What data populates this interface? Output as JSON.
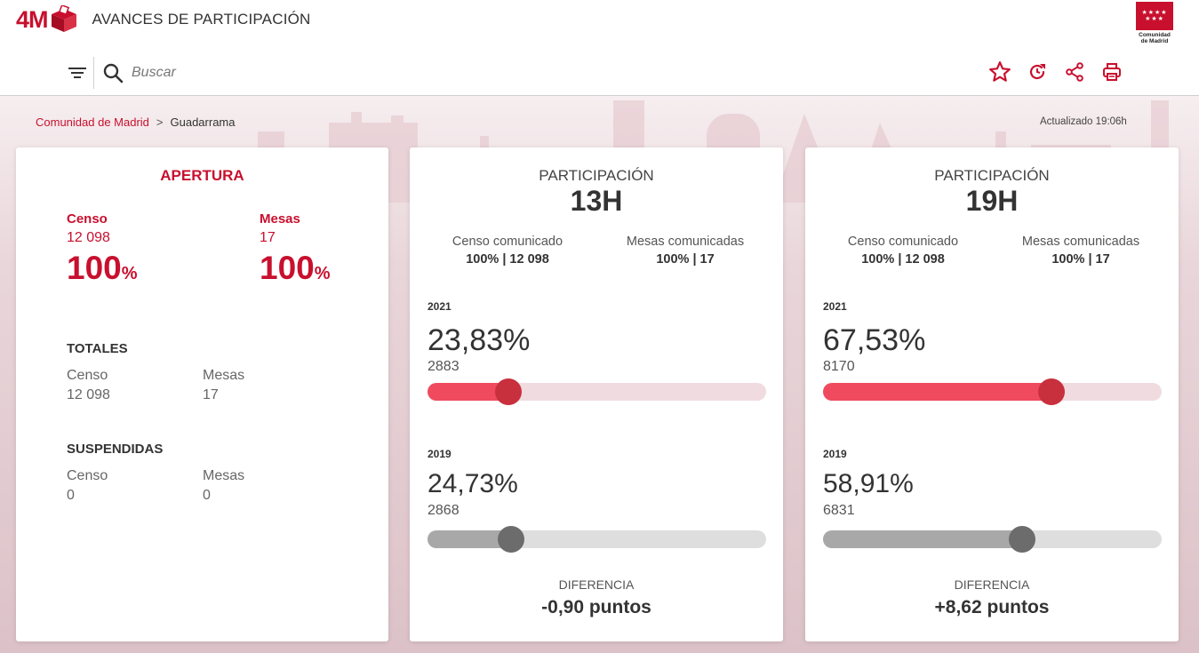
{
  "header": {
    "logo_text": "4M",
    "title": "AVANCES DE PARTICIPACIÓN",
    "brand_logo_text": "Comunidad de Madrid",
    "search_placeholder": "Buscar",
    "icons": [
      "filter-icon",
      "search-icon",
      "star-icon",
      "refresh-icon",
      "share-icon",
      "print-icon"
    ],
    "accent_color": "#c8102e"
  },
  "breadcrumb": {
    "root": "Comunidad de Madrid",
    "separator": ">",
    "current": "Guadarrama"
  },
  "updated": "Actualizado 19:06h",
  "apertura": {
    "title": "APERTURA",
    "censo_label": "Censo",
    "censo_value": "12 098",
    "censo_pct": "100",
    "mesas_label": "Mesas",
    "mesas_value": "17",
    "mesas_pct": "100",
    "pct_symbol": "%",
    "totales": {
      "title": "TOTALES",
      "censo_label": "Censo",
      "censo_value": "12 098",
      "mesas_label": "Mesas",
      "mesas_value": "17"
    },
    "suspendidas": {
      "title": "SUSPENDIDAS",
      "censo_label": "Censo",
      "censo_value": "0",
      "mesas_label": "Mesas",
      "mesas_value": "0"
    }
  },
  "participacion": [
    {
      "heading": "PARTICIPACIÓN",
      "hour": "13H",
      "censo_label": "Censo comunicado",
      "censo_value": "100% | 12 098",
      "mesas_label": "Mesas comunicadas",
      "mesas_value": "100% | 17",
      "y2021": {
        "year": "2021",
        "pct": "23,83%",
        "votes": "2883",
        "fraction": 0.2383
      },
      "y2019": {
        "year": "2019",
        "pct": "24,73%",
        "votes": "2868",
        "fraction": 0.2473
      },
      "diff_label": "DIFERENCIA",
      "diff_value": "-0,90 puntos"
    },
    {
      "heading": "PARTICIPACIÓN",
      "hour": "19H",
      "censo_label": "Censo comunicado",
      "censo_value": "100% | 12 098",
      "mesas_label": "Mesas comunicadas",
      "mesas_value": "100% | 17",
      "y2021": {
        "year": "2021",
        "pct": "67,53%",
        "votes": "8170",
        "fraction": 0.6753
      },
      "y2019": {
        "year": "2019",
        "pct": "58,91%",
        "votes": "6831",
        "fraction": 0.5891
      },
      "diff_label": "DIFERENCIA",
      "diff_value": "+8,62 puntos"
    }
  ]
}
